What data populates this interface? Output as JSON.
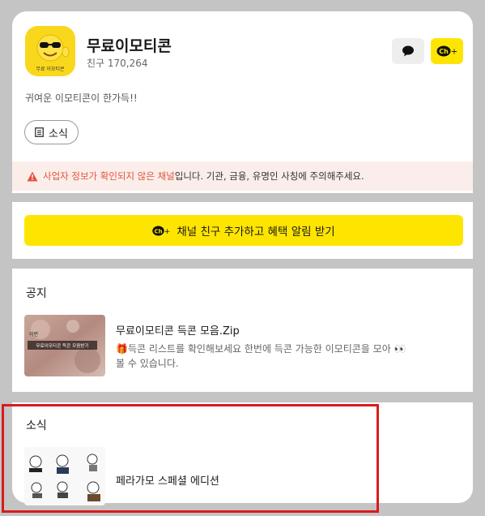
{
  "profile": {
    "name": "무료이모티콘",
    "friends": "친구 170,264",
    "description": "귀여운 이모티콘이 한가득!!",
    "avatar_caption": "무료 이모티콘"
  },
  "buttons": {
    "ch_label": "Ch",
    "ch_plus": "+",
    "news_chip": "소식",
    "add_friend": "채널 친구 추가하고 혜택 알림 받기"
  },
  "warning": {
    "highlight": "사업자 정보가 확인되지 않은 채널",
    "rest": "입니다. 기관, 금융, 유명인 사칭에 주의해주세요."
  },
  "notice": {
    "section_title": "공지",
    "thumb_text_top": "이번",
    "thumb_text": "무료이모티콘 득콘 모음받기",
    "post_title": "무료이모티콘 득콘 모음.Zip",
    "post_gift": "🎁",
    "post_body": "득콘 리스트를 확인해보세요 한번에 득콘 가능한 이모티콘을 모아",
    "post_eyes": "👀",
    "post_body2": "볼 수 있습니다."
  },
  "news": {
    "section_title": "소식",
    "post_title": "페라가모 스페셜 에디션"
  },
  "colors": {
    "accent_yellow": "#fee500",
    "warning_red": "#e0553c",
    "highlight_red": "#d81b1b"
  }
}
